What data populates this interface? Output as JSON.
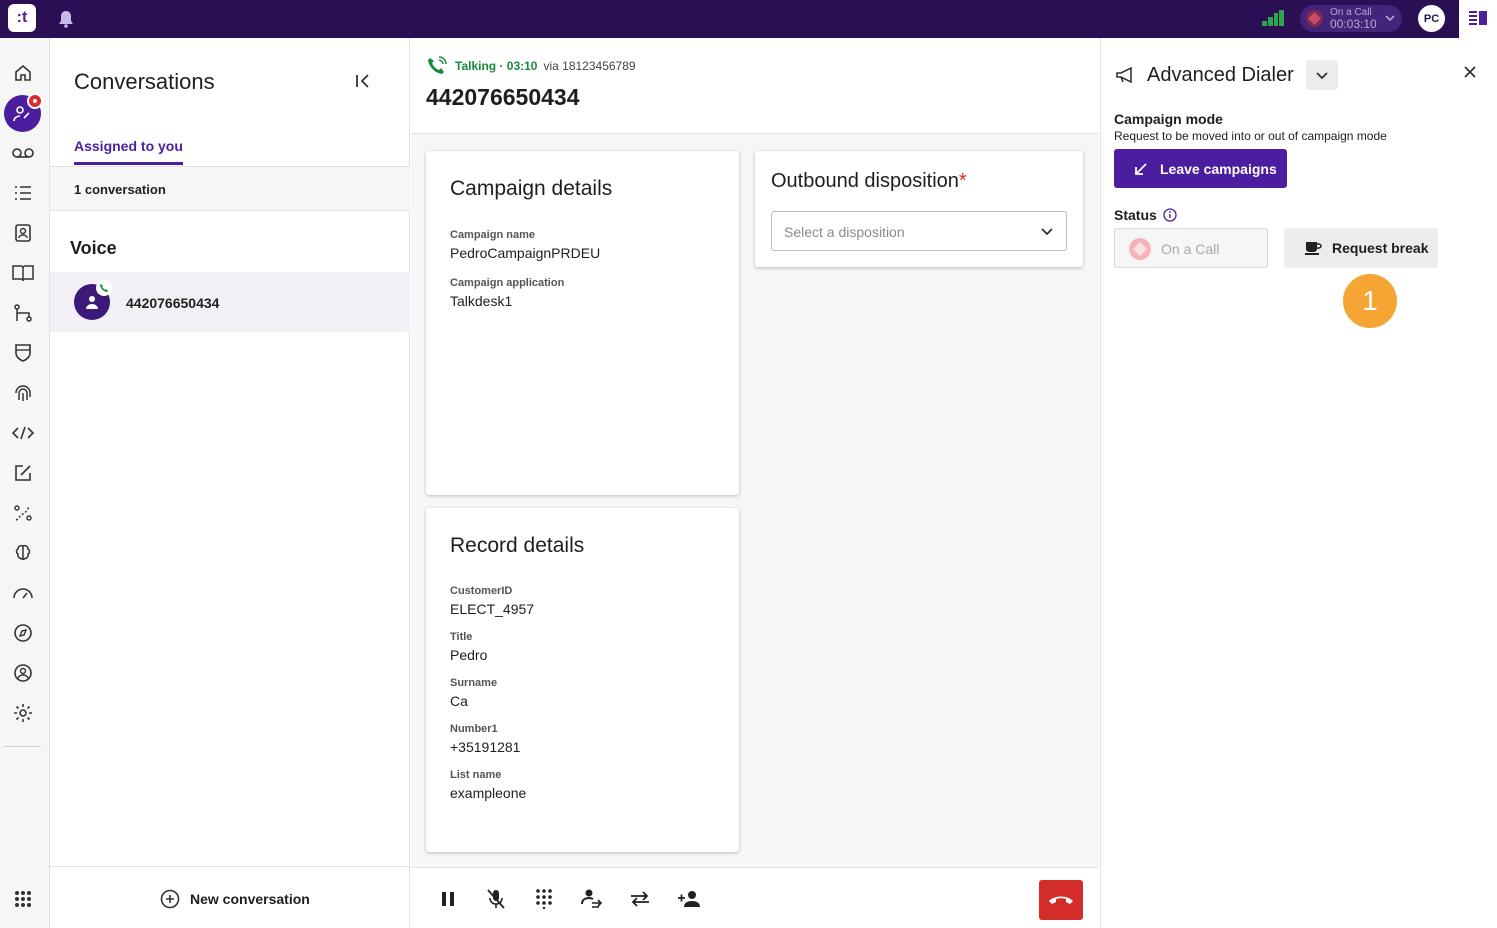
{
  "topbar": {
    "logo_text": ":t",
    "status": {
      "label": "On a Call",
      "timer": "00:03:10"
    },
    "avatar_initials": "PC",
    "icons": [
      "bell-icon",
      "signal-icon",
      "chevron-down-icon",
      "panel-toggle-icon"
    ]
  },
  "rail": {
    "icons": [
      "home-icon",
      "conversations-icon",
      "voicemail-icon",
      "list-icon",
      "contacts-icon",
      "knowledge-icon",
      "flows-icon",
      "shield-icon",
      "fingerprint-icon",
      "code-icon",
      "edit-icon",
      "analytics-icon",
      "brain-icon",
      "speed-icon",
      "compass-icon",
      "user-circle-icon",
      "settings-icon",
      "apps-grid-icon"
    ]
  },
  "conversations": {
    "title": "Conversations",
    "tab_label": "Assigned to you",
    "count_label": "1 conversation",
    "section_label": "Voice",
    "items": [
      {
        "number": "442076650434"
      }
    ],
    "new_conversation_label": "New conversation"
  },
  "call": {
    "talking_label": "Talking · 03:10",
    "via_label": "via 18123456789",
    "number": "442076650434"
  },
  "campaign_details": {
    "title": "Campaign details",
    "fields": [
      {
        "label": "Campaign name",
        "value": "PedroCampaignPRDEU"
      },
      {
        "label": "Campaign application",
        "value": "Talkdesk1"
      }
    ]
  },
  "record_details": {
    "title": "Record details",
    "fields": [
      {
        "label": "CustomerID",
        "value": "ELECT_4957"
      },
      {
        "label": "Title",
        "value": "Pedro"
      },
      {
        "label": "Surname",
        "value": "Ca"
      },
      {
        "label": "Number1",
        "value": "+35191281"
      },
      {
        "label": "List name",
        "value": "exampleone"
      }
    ]
  },
  "disposition": {
    "title": "Outbound disposition",
    "required_mark": "*",
    "placeholder": "Select a disposition"
  },
  "toolbar": {
    "buttons": [
      "pause-icon",
      "mute-icon",
      "keypad-icon",
      "consult-icon",
      "transfer-icon",
      "add-participant-icon"
    ],
    "hangup_icon": "hangup-icon"
  },
  "dialer": {
    "title": "Advanced Dialer",
    "campaign_mode_title": "Campaign mode",
    "campaign_mode_subtitle": "Request to be moved into or out of campaign mode",
    "leave_button": "Leave campaigns",
    "status_title": "Status",
    "on_call_label": "On a Call",
    "request_break_label": "Request break",
    "step_badge": "1"
  },
  "colors": {
    "brand_dark": "#2b0f55",
    "brand_primary": "#4b1ea0",
    "talking_green": "#1a8a3e",
    "hangup_red": "#d42b2b",
    "badge_orange": "#f5a533"
  }
}
